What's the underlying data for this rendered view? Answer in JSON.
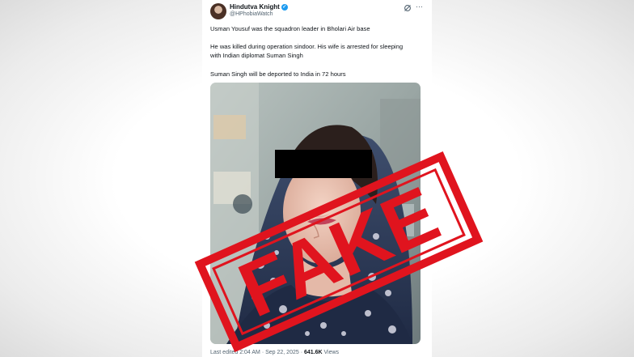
{
  "author": {
    "display_name": "Hindutva Knight",
    "handle": "@HPhobiaWatch",
    "verified_badge": "✓"
  },
  "header_icons": {
    "grok": "grok-icon",
    "more": "⋯"
  },
  "tweet": {
    "line1": "Usman Yousuf was the squadron leader in Bholari Air base",
    "line2": "He was killed during operation sindoor. His wife is arrested for sleeping",
    "line3": "with Indian diplomat Suman Singh",
    "line4": "Suman Singh will be deported to India in 72 hours"
  },
  "stamp": {
    "text": "FAKE",
    "color": "#e0141e"
  },
  "meta": {
    "edited": "Last edited 2:04 AM · Sep 22, 2025 · ",
    "views_count": "641.6K",
    "views_label": " Views"
  },
  "colors": {
    "verified": "#1d9bf0",
    "text": "#0f1419",
    "secondary": "#536471"
  }
}
